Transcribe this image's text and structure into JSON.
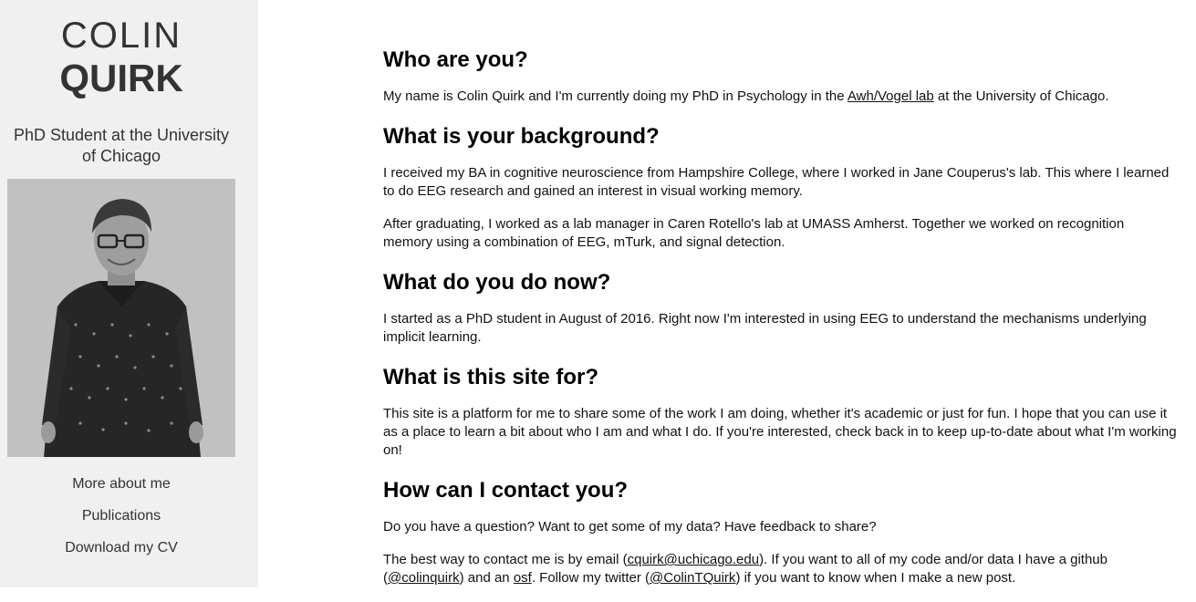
{
  "sidebar": {
    "first_name": "COLIN",
    "last_name": "QUIRK",
    "tagline": "PhD Student at the University of Chicago",
    "nav": [
      {
        "label": "More about me"
      },
      {
        "label": "Publications"
      },
      {
        "label": "Download my CV"
      }
    ]
  },
  "main": {
    "sections": [
      {
        "heading": "Who are you?",
        "p1_a": "My name is Colin Quirk and I'm currently doing my PhD in Psychology in the ",
        "p1_link": "Awh/Vogel lab",
        "p1_b": " at the University of Chicago."
      },
      {
        "heading": "What is your background?",
        "p1": "I received my BA in cognitive neuroscience from Hampshire College, where I worked in Jane Couperus's lab. This where I learned to do EEG research and gained an interest in visual working memory.",
        "p2": "After graduating, I worked as a lab manager in Caren Rotello's lab at UMASS Amherst. Together we worked on recognition memory using a combination of EEG, mTurk, and signal detection."
      },
      {
        "heading": "What do you do now?",
        "p1": "I started as a PhD student in August of 2016. Right now I'm interested in using EEG to understand the mechanisms underlying implicit learning."
      },
      {
        "heading": "What is this site for?",
        "p1": "This site is a platform for me to share some of the work I am doing, whether it's academic or just for fun. I hope that you can use it as a place to learn a bit about who I am and what I do. If you're interested, check back in to keep up-to-date about what I'm working on!"
      },
      {
        "heading": "How can I contact you?",
        "p1": "Do you have a question? Want to get some of my data? Have feedback to share?",
        "p2_a": "The best way to contact me is by email (",
        "p2_email": "cquirk@uchicago.edu",
        "p2_b": "). If you want to all of my code and/or data I have a github (",
        "p2_github": "@colinquirk",
        "p2_c": ") and an ",
        "p2_osf": "osf",
        "p2_d": ". Follow my twitter (",
        "p2_twitter": "@ColinTQuirk",
        "p2_e": ") if you want to know when I make a new post."
      }
    ]
  }
}
